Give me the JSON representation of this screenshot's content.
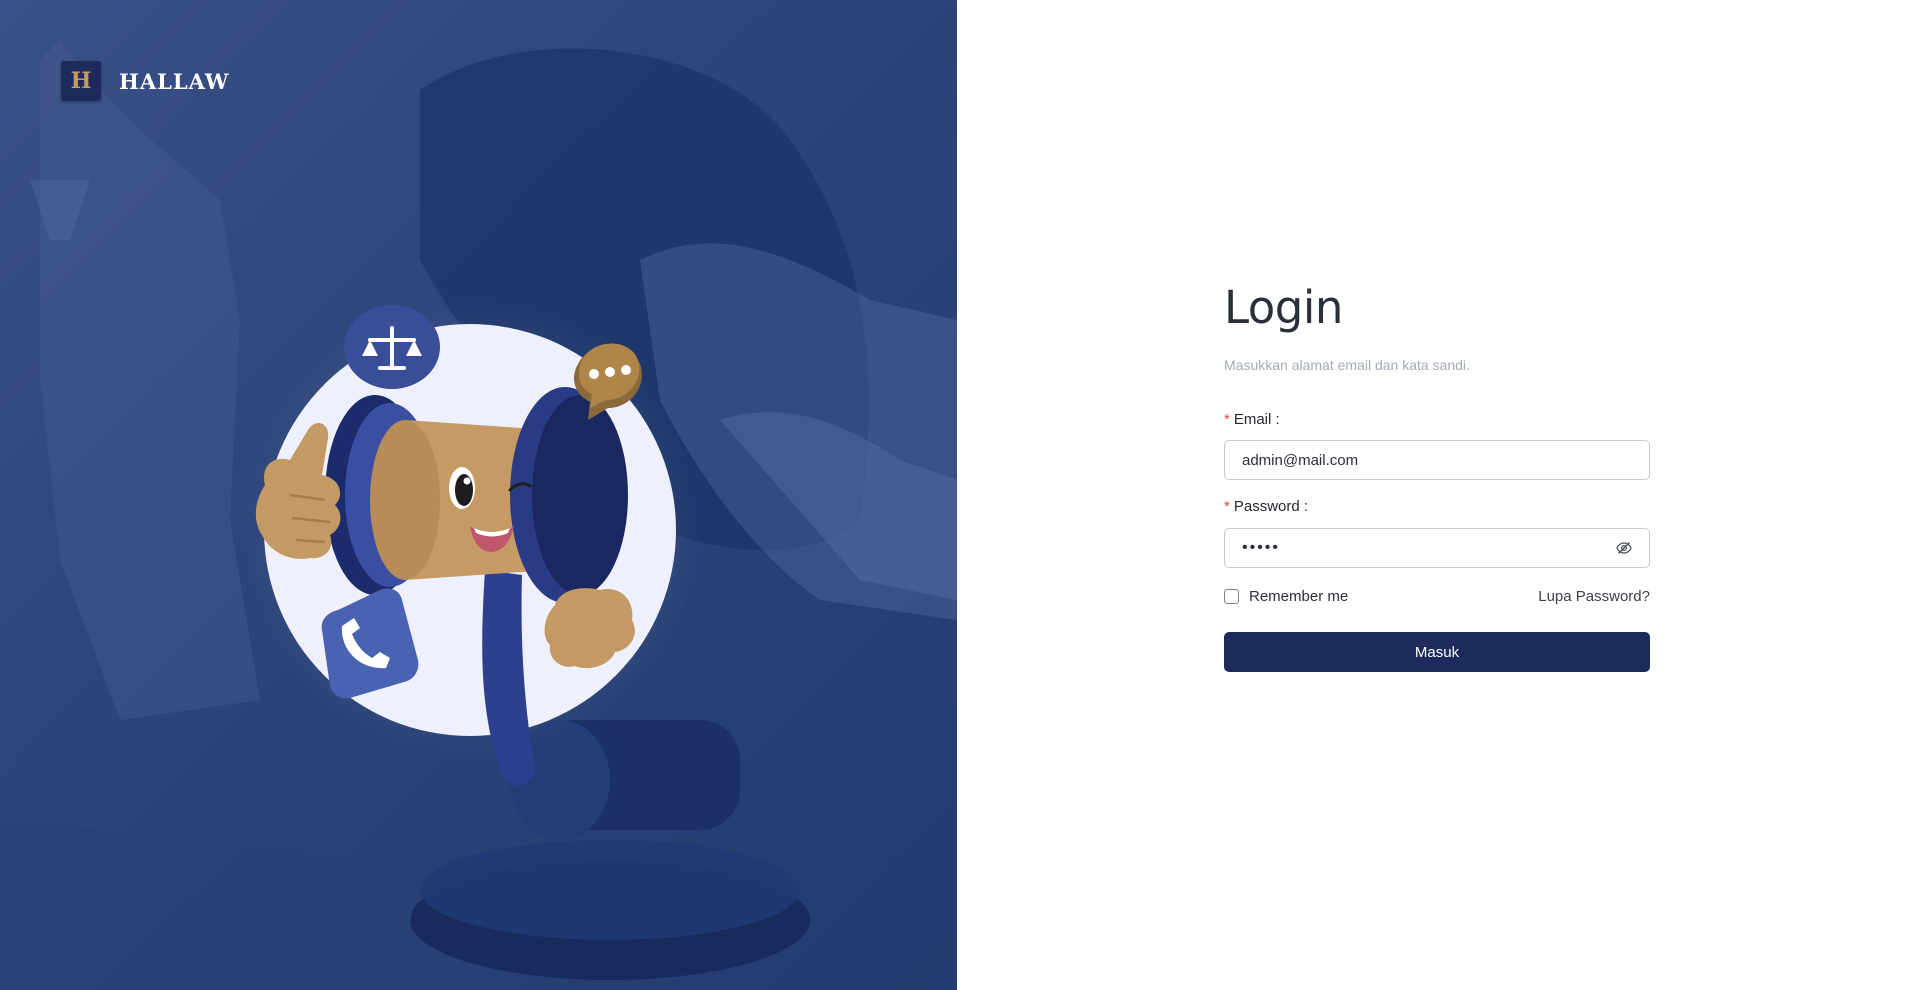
{
  "brand": {
    "mark": "H",
    "name": "HALLAW"
  },
  "login": {
    "title": "Login",
    "subtitle": "Masukkan alamat email dan kata sandi.",
    "email": {
      "label": "Email :",
      "required_mark": "*",
      "value": "admin@mail.com"
    },
    "password": {
      "label": "Password :",
      "required_mark": "*",
      "value": "•••••"
    },
    "remember_label": "Remember me",
    "forgot_label": "Lupa Password?",
    "submit_label": "Masuk"
  },
  "icons": {
    "brand_mark": "h-logo-icon",
    "scales": "scales-of-justice-icon",
    "chat": "chat-bubble-icon",
    "phone": "phone-icon",
    "eye": "eye-off-icon",
    "mascot": "gavel-mascot-illustration"
  },
  "colors": {
    "panel_blue": "#2c4479",
    "primary_button": "#1c2a5c",
    "gold": "#c49a64",
    "required": "#e5484d"
  }
}
